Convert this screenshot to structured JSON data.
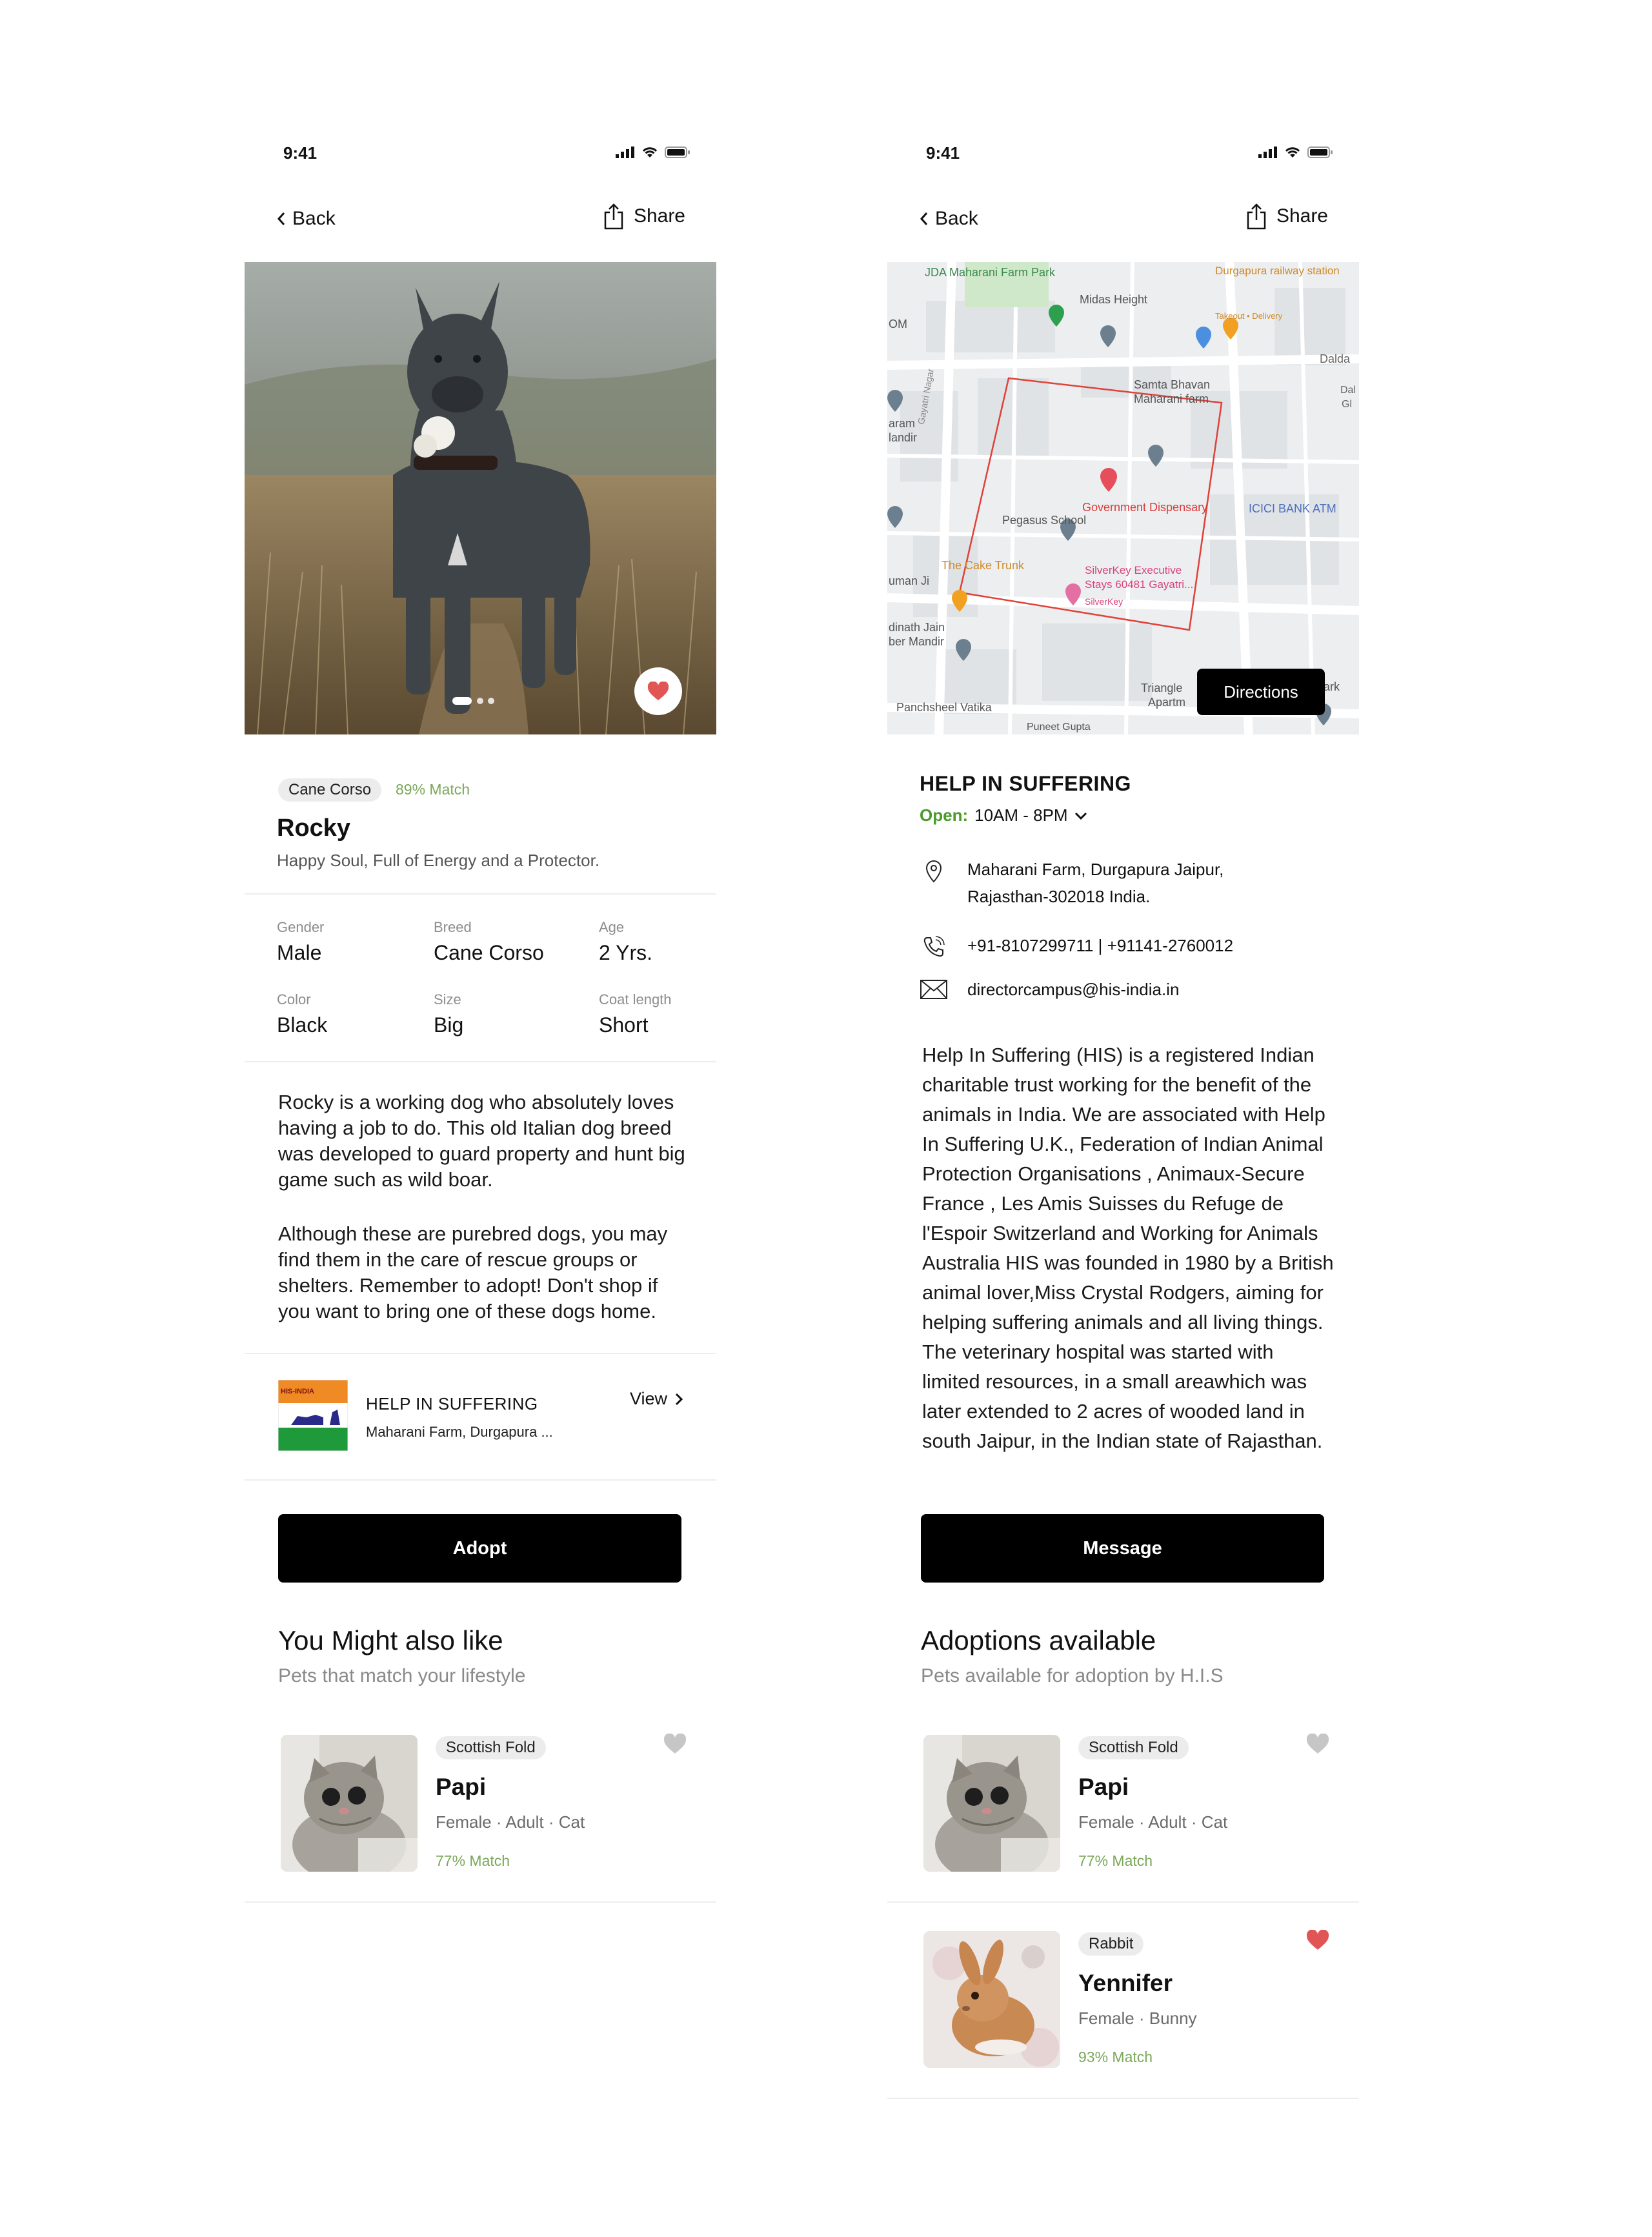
{
  "status": {
    "time": "9:41"
  },
  "nav": {
    "back_label": "Back",
    "share_label": "Share"
  },
  "pet_detail": {
    "breed_tag": "Cane Corso",
    "match": "89% Match",
    "name": "Rocky",
    "tagline": "Happy Soul, Full of Energy and a Protector.",
    "attributes": [
      {
        "label": "Gender",
        "value": "Male"
      },
      {
        "label": "Breed",
        "value": "Cane Corso"
      },
      {
        "label": "Age",
        "value": "2 Yrs."
      },
      {
        "label": "Color",
        "value": "Black"
      },
      {
        "label": "Size",
        "value": "Big"
      },
      {
        "label": "Coat length",
        "value": "Short"
      }
    ],
    "description": [
      "Rocky is a working dog who absolutely loves having a job to do. This old Italian dog breed was developed to guard property and hunt big game such as wild boar.",
      "Although these are purebred dogs, you may find them in the care of rescue groups or shelters. Remember to adopt! Don't shop if you want to bring one of these dogs home."
    ],
    "shelter": {
      "logo_text": "HIS-INDIA",
      "name": "HELP IN SUFFERING",
      "address": "Maharani Farm, Durgapura ...",
      "view_label": "View"
    },
    "adopt_label": "Adopt",
    "similar": {
      "title": "You Might also like",
      "subtitle": "Pets that match your lifestyle",
      "items": [
        {
          "tag": "Scottish Fold",
          "name": "Papi",
          "meta": "Female · Adult · Cat",
          "match": "77% Match",
          "favorited": false
        }
      ]
    }
  },
  "shelter_detail": {
    "map": {
      "directions_label": "Directions",
      "labels": [
        "JDA Maharani Farm Park",
        "Midas Height",
        "Durgapura railway station",
        "Takeout • Delivery",
        "Dalda",
        "Samta Bhavan",
        "Maharani farm",
        "Gayatri Nagar",
        "Government Dispensary",
        "Pegasus School",
        "ICICI BANK ATM",
        "The Cake Trunk",
        "SilverKey Executive",
        "Stays 60481 Gayatri...",
        "Triangle",
        "Apartm",
        "Panchsheel Vatika",
        "Puneet Gupta",
        "OM",
        "aram",
        "landir",
        "uman Ji",
        "dinath Jain",
        "ber Mandir",
        "ark",
        "Dal",
        "Gl",
        "SilverKey"
      ]
    },
    "name": "HELP IN SUFFERING",
    "open_label": "Open:",
    "hours": "10AM - 8PM",
    "address": [
      "Maharani Farm, Durgapura Jaipur,",
      "Rajasthan-302018 India."
    ],
    "phone": "+91-8107299711 | +91141-2760012",
    "email": "directorcampus@his-india.in",
    "about": "Help In Suffering (HIS) is a registered Indian charitable trust working for the benefit of the animals in India. We are associated with Help In Suffering U.K., Federation of Indian Animal Protection Organisations , Animaux-Secure France , Les Amis Suisses du Refuge de l'Espoir Switzerland and Working for Animals Australia HIS was founded in 1980 by a British animal lover,Miss Crystal Rodgers, aiming for helping suffering animals and all living things. The veterinary hospital was started with limited resources, in a small areawhich was later extended to 2 acres of wooded land in south Jaipur, in the Indian state of Rajasthan.",
    "message_label": "Message",
    "adoptions": {
      "title": "Adoptions available",
      "subtitle": "Pets available for adoption by H.I.S",
      "items": [
        {
          "tag": "Scottish Fold",
          "name": "Papi",
          "meta": "Female · Adult · Cat",
          "match": "77% Match",
          "favorited": false
        },
        {
          "tag": "Rabbit",
          "name": "Yennifer",
          "meta": "Female · Bunny",
          "match": "93% Match",
          "favorited": true
        }
      ]
    }
  },
  "colors": {
    "accent_green": "#7aa85a",
    "heart_red": "#e25555",
    "map_boundary": "#e0413a",
    "button_black": "#000000"
  }
}
